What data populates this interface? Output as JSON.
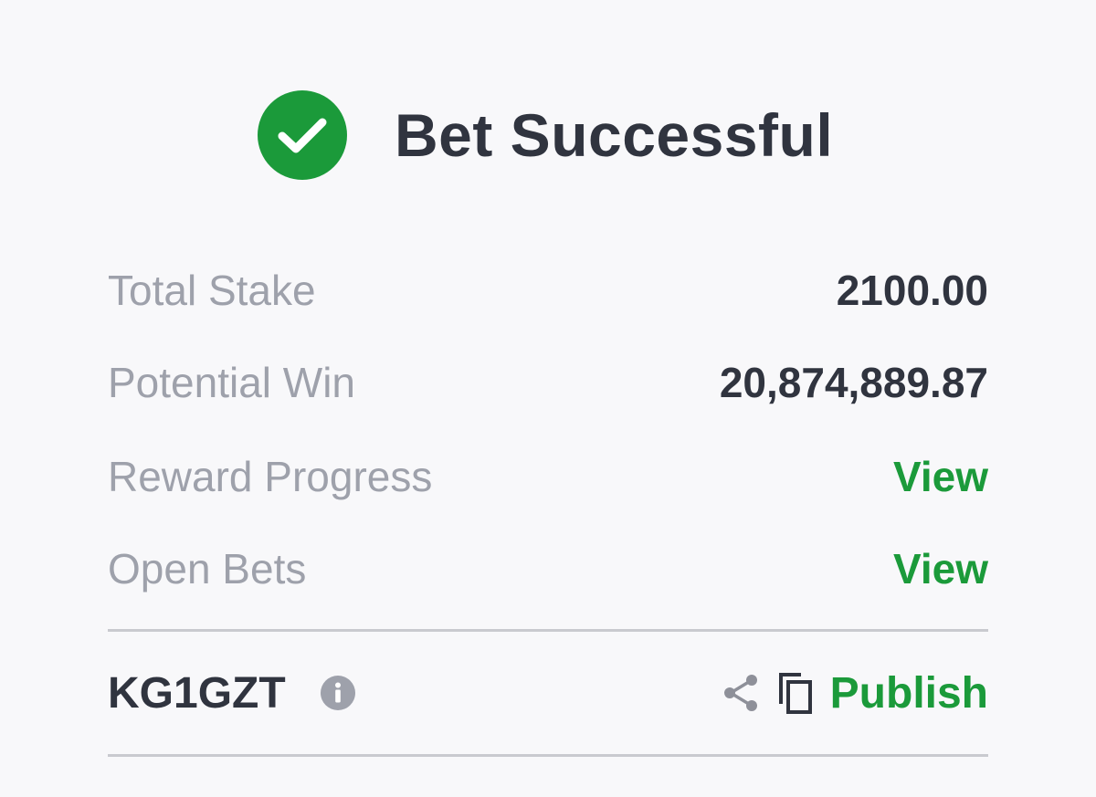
{
  "header": {
    "title": "Bet Successful",
    "icon": "check-circle-icon",
    "icon_color": "#1b9a3a"
  },
  "summary": {
    "rows": [
      {
        "label": "Total Stake",
        "value": "2100.00"
      },
      {
        "label": "Potential Win",
        "value": "20,874,889.87"
      },
      {
        "label": "Reward Progress",
        "value": "View"
      },
      {
        "label": "Open Bets",
        "value": "View"
      }
    ]
  },
  "booking": {
    "code": "KG1GZT",
    "info_icon": "info-icon",
    "share_icon": "share-icon",
    "copy_icon": "copy-icon",
    "publish_label": "Publish"
  },
  "colors": {
    "accent": "#1b9a3a",
    "text_dark": "#30343f",
    "text_muted": "#9ea1ab",
    "divider": "#c9cacf",
    "background": "#f8f8fa"
  }
}
